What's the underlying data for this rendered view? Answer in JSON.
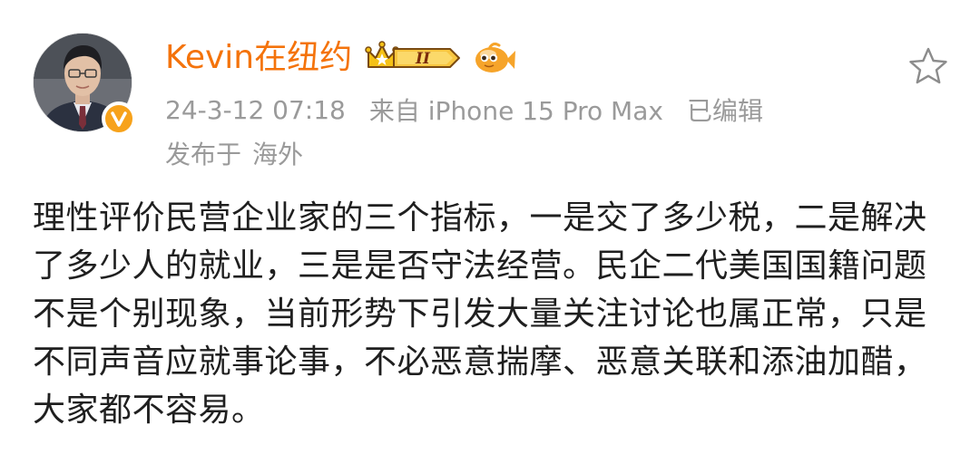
{
  "post": {
    "username": "Kevin在纽约",
    "level": "II",
    "time": "24-3-12 07:18",
    "source": "来自 iPhone 15 Pro Max",
    "edited": "已编辑",
    "region_prefix": "发布于",
    "region": "海外",
    "content": "理性评价民营企业家的三个指标，一是交了多少税，二是解决了多少人的就业，三是是否守法经营。民企二代美国国籍问题不是个别现象，当前形势下引发大量关注讨论也属正常，只是不同声音应就事论事，不必恶意揣摩、恶意关联和添油加醋，大家都不容易。"
  },
  "icons": {
    "verified": "verified-v-icon",
    "level": "crown-level-badge-icon",
    "fan": "fan-fish-icon",
    "favorite": "star-outline-icon"
  },
  "colors": {
    "username": "#f4730b",
    "meta": "#9a9a9a",
    "verified_badge": "#f7a21b",
    "text": "#1f1f1f"
  }
}
